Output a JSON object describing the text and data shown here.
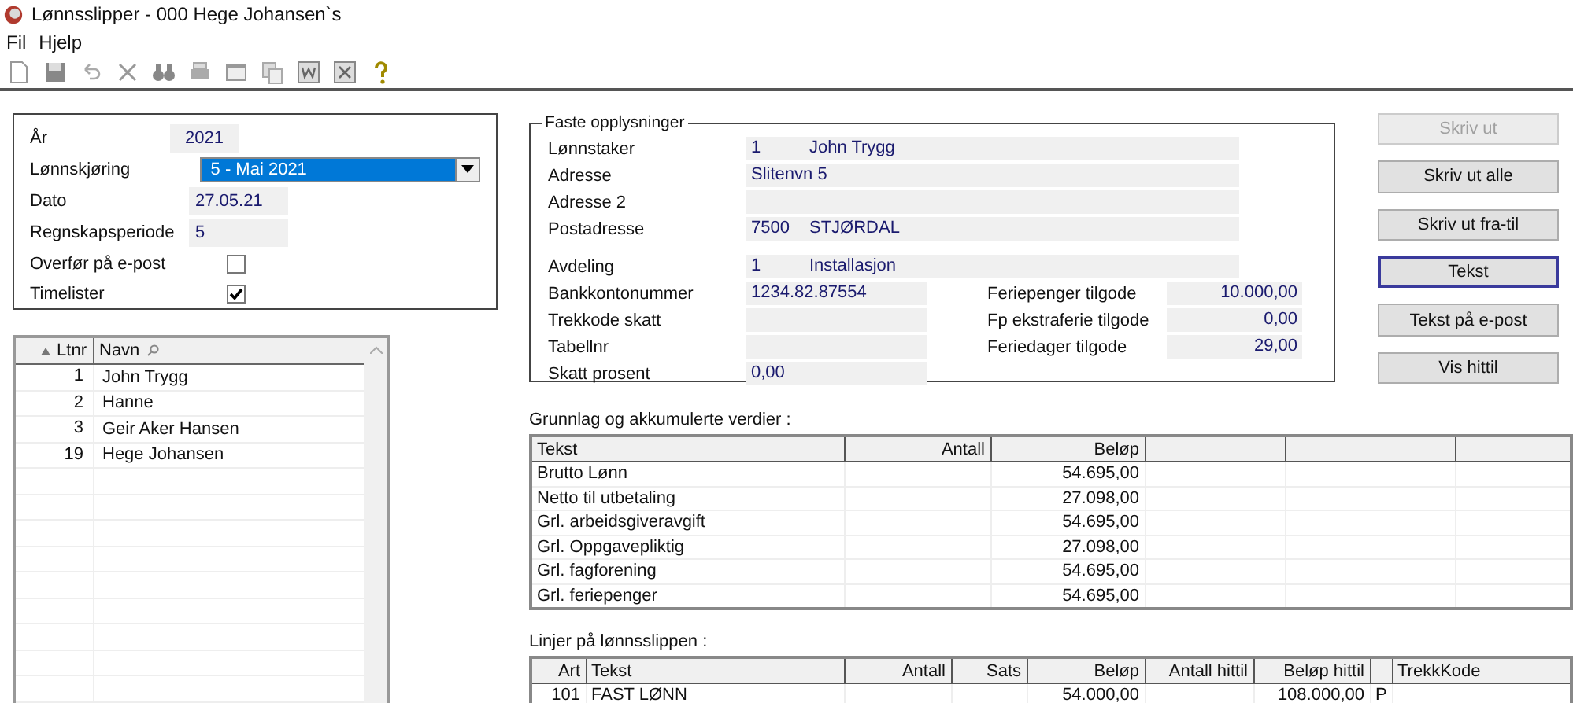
{
  "window": {
    "title": "Lønnsslipper - 000 Hege Johansen`s"
  },
  "menu": [
    "Fil",
    "Hjelp"
  ],
  "run_form": {
    "fields": [
      {
        "kind": "text",
        "label": "År",
        "value": "2021"
      },
      {
        "kind": "select",
        "label": "Lønnskjøring",
        "value": "5 - Mai 2021"
      },
      {
        "kind": "text",
        "label": "Dato",
        "value": "27.05.21"
      },
      {
        "kind": "text",
        "label": "Regnskapsperiode",
        "value": "5"
      },
      {
        "kind": "check",
        "label": "Overfør på e-post",
        "checked": false
      },
      {
        "kind": "check",
        "label": "Timelister",
        "checked": true
      }
    ]
  },
  "employee_list": {
    "columns": [
      "Ltnr",
      "Navn"
    ],
    "rows": [
      {
        "nr": "1",
        "name": "John Trygg",
        "selected": false
      },
      {
        "nr": "2",
        "name": "Hanne",
        "selected": false
      },
      {
        "nr": "3",
        "name": "Geir Aker Hansen",
        "selected": false
      },
      {
        "nr": "19",
        "name": "Hege Johansen",
        "selected": false
      }
    ]
  },
  "employee_info": {
    "title": "Faste opplysninger",
    "address_fields": [
      {
        "label": "Lønnstaker",
        "kind": "pair",
        "values": [
          "1",
          "John Trygg"
        ]
      },
      {
        "label": "Adresse",
        "kind": "wide",
        "values": [
          "Slitenvn 5"
        ]
      },
      {
        "label": "Adresse 2",
        "kind": "wide"
      },
      {
        "label": "Postadresse",
        "kind": "pair",
        "values": [
          "7500",
          "STJØRDAL"
        ]
      }
    ],
    "employment_fields": [
      {
        "label": "Avdeling",
        "kind": "pair",
        "values": [
          "1",
          "Installasjon"
        ]
      },
      {
        "label": "Bankkontonummer",
        "kind": "short",
        "values": [
          "1234.82.87554"
        ],
        "balance": {
          "label": "Feriepenger tilgode",
          "value": "10.000,00"
        }
      },
      {
        "label": "Trekkode skatt",
        "kind": "short",
        "balance": {
          "label": "Fp ekstraferie tilgode",
          "value": "0,00"
        }
      },
      {
        "label": "Tabellnr",
        "kind": "short",
        "balance": {
          "label": "Feriedager tilgode",
          "value": "29,00"
        }
      },
      {
        "label": "Skatt prosent",
        "kind": "short",
        "values": [
          "0,00"
        ]
      }
    ]
  },
  "buttons": [
    {
      "label": "Skriv ut",
      "disabled": true,
      "focused": false
    },
    {
      "label": "Skriv ut alle",
      "disabled": false,
      "focused": false
    },
    {
      "label": "Skriv ut fra-til",
      "disabled": false,
      "focused": false
    },
    {
      "label": "Tekst",
      "disabled": false,
      "focused": true
    },
    {
      "label": "Tekst på e-post",
      "disabled": false,
      "focused": false
    },
    {
      "label": "Vis hittil",
      "disabled": false,
      "focused": false
    }
  ],
  "totals_table": {
    "title": "Grunnlag og akkumulerte verdier :",
    "columns": [
      {
        "kind": "text",
        "label": "Tekst"
      },
      {
        "kind": "text",
        "label": "Antall"
      },
      {
        "kind": "text",
        "label": "Beløp"
      },
      {
        "kind": "blank"
      },
      {
        "kind": "blank"
      },
      {
        "kind": "blank"
      }
    ],
    "rows": [
      {
        "tekst": "Brutto Lønn",
        "belop": "54.695,00"
      },
      {
        "tekst": "Netto til utbetaling",
        "belop": "27.098,00"
      },
      {
        "tekst": "Grl. arbeidsgiveravgift",
        "belop": "54.695,00"
      },
      {
        "tekst": "Grl. Oppgavepliktig",
        "belop": "27.098,00"
      },
      {
        "tekst": "Grl. fagforening",
        "belop": "54.695,00"
      },
      {
        "tekst": "Grl. feriepenger",
        "belop": "54.695,00"
      }
    ]
  },
  "lines_table": {
    "title": "Linjer på lønnsslippen :",
    "columns": [
      {
        "kind": "text",
        "label": "Art"
      },
      {
        "kind": "text",
        "label": "Tekst"
      },
      {
        "kind": "text",
        "label": "Antall"
      },
      {
        "kind": "text",
        "label": "Sats"
      },
      {
        "kind": "text",
        "label": "Beløp"
      },
      {
        "kind": "text",
        "label": "Antall hittil"
      },
      {
        "kind": "text",
        "label": "Beløp hittil"
      },
      {
        "kind": "blank"
      },
      {
        "kind": "text",
        "label": "TrekkKode"
      }
    ],
    "rows": [
      {
        "art": "101",
        "tekst": "FAST LØNN",
        "belop": "54.000,00",
        "belop_hittil": "108.000,00",
        "column_8": "P"
      }
    ]
  }
}
